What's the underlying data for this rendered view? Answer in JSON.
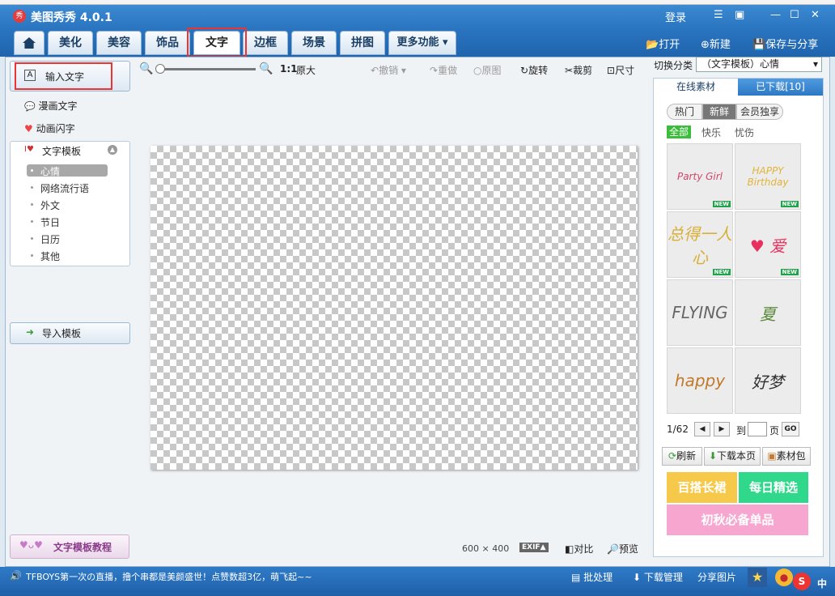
{
  "app": {
    "title": "美图秀秀 4.0.1",
    "logo_text": "秀",
    "login": "登录"
  },
  "window_controls": {
    "min": "—",
    "max": "☐",
    "close": "✕",
    "msg": "☰",
    "skin": "▣"
  },
  "tabs": [
    "美化",
    "美容",
    "饰品",
    "文字",
    "边框",
    "场景",
    "拼图",
    "更多功能"
  ],
  "active_tab": "文字",
  "top_actions": {
    "open": "打开",
    "new": "新建",
    "save_share": "保存与分享"
  },
  "left": {
    "input_text": "输入文字",
    "comic_text": "漫画文字",
    "anim_text": "动画闪字",
    "template_header": "文字模板",
    "template_items": [
      "心情",
      "网络流行语",
      "外文",
      "节日",
      "日历",
      "其他"
    ],
    "import_template": "导入模板",
    "tutorial": "文字模板教程"
  },
  "toolbar": {
    "ratio": "1:1",
    "original_size": "原大",
    "undo": "撤销",
    "redo": "重做",
    "original": "原图",
    "rotate": "旋转",
    "crop": "裁剪",
    "size": "尺寸"
  },
  "canvas": {
    "dimensions": "600 × 400",
    "exif": "EXIF▲",
    "compare": "对比",
    "preview": "预览"
  },
  "right": {
    "switch_label": "切换分类",
    "category": "（文字模板）心情",
    "tab_online": "在线素材",
    "tab_downloaded": "已下载[10]",
    "pills": [
      "热门",
      "新鲜",
      "会员独享"
    ],
    "filters": [
      "全部",
      "快乐",
      "忧伤"
    ],
    "thumbs": [
      {
        "art": "Party Girl",
        "new": "NEW",
        "color": "#d0476b"
      },
      {
        "art": "HAPPY Birthday",
        "new": "NEW",
        "color": "#e0b43a"
      },
      {
        "art": "总得一人心",
        "new": "NEW",
        "color": "#d8b038"
      },
      {
        "art": "♥ 爱",
        "new": "NEW",
        "color": "#e8305c"
      },
      {
        "art": "FLYING",
        "new": "",
        "color": "#666666"
      },
      {
        "art": "夏",
        "new": "",
        "color": "#5a8a3a"
      },
      {
        "art": "happy",
        "new": "",
        "color": "#c07a2a"
      },
      {
        "art": "好梦",
        "new": "",
        "color": "#333333"
      }
    ],
    "pager": {
      "page": "1/62",
      "prev": "◀",
      "next": "▶",
      "to": "到",
      "page_unit": "页",
      "go": "GO"
    },
    "actions": {
      "refresh": "刷新",
      "download_page": "下载本页",
      "material_pack": "素材包"
    },
    "promos": [
      "百搭长裙",
      "每日精选",
      "初秋必备单品"
    ]
  },
  "status": {
    "news": "TFBOYS第一次の直播，撸个串都是美颜盛世！点赞数超3亿，萌飞起~~",
    "batch": "批处理",
    "download_mgr": "下载管理",
    "share_pic": "分享图片",
    "ime": "中"
  }
}
